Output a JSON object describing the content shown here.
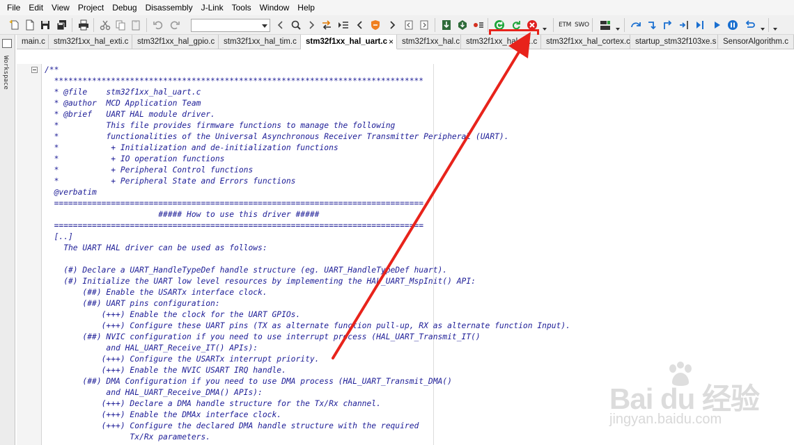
{
  "menu": [
    "File",
    "Edit",
    "View",
    "Project",
    "Debug",
    "Disassembly",
    "J-Link",
    "Tools",
    "Window",
    "Help"
  ],
  "toolbar": {
    "search_value": "",
    "etm_label": "ETM",
    "swo_label": "SWO"
  },
  "tabs": [
    {
      "label": "main.c",
      "active": false
    },
    {
      "label": "stm32f1xx_hal_exti.c",
      "active": false
    },
    {
      "label": "stm32f1xx_hal_gpio.c",
      "active": false
    },
    {
      "label": "stm32f1xx_hal_tim.c",
      "active": false
    },
    {
      "label": "stm32f1xx_hal_uart.c",
      "active": true,
      "close": "×"
    },
    {
      "label": "stm32f1xx_hal.c",
      "active": false
    },
    {
      "label": "stm32f1xx_hal_a...c",
      "active": false
    },
    {
      "label": "stm32f1xx_hal_cortex.c",
      "active": false
    },
    {
      "label": "startup_stm32f103xe.s",
      "active": false
    },
    {
      "label": "SensorAlgorithm.c",
      "active": false
    }
  ],
  "workspace_label": "Workspace",
  "code_lines": [
    "/**",
    "  ******************************************************************************",
    "  * @file    stm32f1xx_hal_uart.c",
    "  * @author  MCD Application Team",
    "  * @brief   UART HAL module driver.",
    "  *          This file provides firmware functions to manage the following",
    "  *          functionalities of the Universal Asynchronous Receiver Transmitter Peripheral (UART).",
    "  *           + Initialization and de-initialization functions",
    "  *           + IO operation functions",
    "  *           + Peripheral Control functions",
    "  *           + Peripheral State and Errors functions",
    "  @verbatim",
    "  ==============================================================================",
    "                        ##### How to use this driver #####",
    "  ==============================================================================",
    "  [..]",
    "    The UART HAL driver can be used as follows:",
    "",
    "    (#) Declare a UART_HandleTypeDef handle structure (eg. UART_HandleTypeDef huart).",
    "    (#) Initialize the UART low level resources by implementing the HAL_UART_MspInit() API:",
    "        (##) Enable the USARTx interface clock.",
    "        (##) UART pins configuration:",
    "            (+++) Enable the clock for the UART GPIOs.",
    "            (+++) Configure these UART pins (TX as alternate function pull-up, RX as alternate function Input).",
    "        (##) NVIC configuration if you need to use interrupt process (HAL_UART_Transmit_IT()",
    "             and HAL_UART_Receive_IT() APIs):",
    "            (+++) Configure the USARTx interrupt priority.",
    "            (+++) Enable the NVIC USART IRQ handle.",
    "        (##) DMA Configuration if you need to use DMA process (HAL_UART_Transmit_DMA()",
    "             and HAL_UART_Receive_DMA() APIs):",
    "            (+++) Declare a DMA handle structure for the Tx/Rx channel.",
    "            (+++) Enable the DMAx interface clock.",
    "            (+++) Configure the declared DMA handle structure with the required",
    "                  Tx/Rx parameters."
  ],
  "watermark": {
    "main": "Bai du 经验",
    "sub": "jingyan.baidu.com"
  },
  "colors": {
    "annotation": "#e8231b",
    "code_comment": "#1c1c96"
  }
}
